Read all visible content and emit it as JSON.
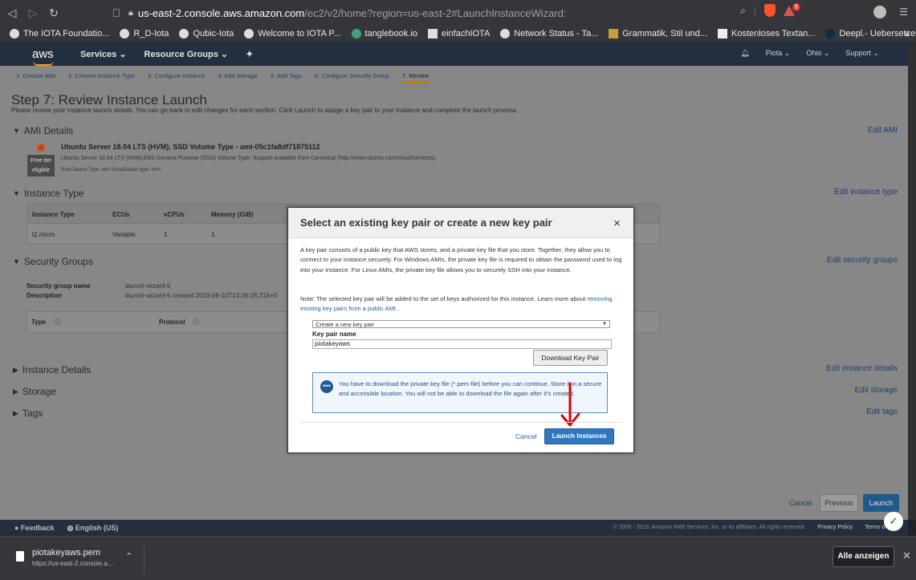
{
  "browser": {
    "url_host": "us-east-2.console.aws.amazon.com",
    "url_path": "/ec2/v2/home?region=us-east-2#LaunchInstanceWizard:",
    "shield_badge": "8",
    "bookmarks": [
      "The IOTA Foundatio...",
      "R_D-Iota",
      "Qubic-Iota",
      "Welcome to IOTA P...",
      "tanglebook.io",
      "einfachIOTA",
      "Network Status - Ta...",
      "Grammatik, Stil und...",
      "Kostenloses Textan...",
      "Deepl.- Uebersetzer"
    ],
    "more": "»"
  },
  "aws": {
    "logo": "aws",
    "services": "Services ⌄",
    "resource_groups": "Resource Groups ⌄",
    "pin": "✦",
    "bell": "♫",
    "user": "Piota ⌄",
    "region": "Ohio ⌄",
    "support": "Support ⌄"
  },
  "wizard": {
    "steps": [
      "1. Choose AMI",
      "2. Choose Instance Type",
      "3. Configure Instance",
      "4. Add Storage",
      "5. Add Tags",
      "6. Configure Security Group",
      "7. Review"
    ],
    "title": "Step 7: Review Instance Launch",
    "description": "Please review your instance launch details. You can go back to edit changes for each section. Click Launch to assign a key pair to your instance and complete the launch process.",
    "sections": {
      "ami": "AMI Details",
      "instance_type": "Instance Type",
      "security_groups": "Security Groups",
      "instance_details": "Instance Details",
      "storage": "Storage",
      "tags": "Tags"
    },
    "edits": {
      "ami": "Edit AMI",
      "instance_type": "Edit instance type",
      "security_groups": "Edit security groups",
      "instance_details": "Edit instance details",
      "storage": "Edit storage",
      "tags": "Edit tags"
    },
    "ami_name": "Ubuntu Server 18.04 LTS (HVM), SSD Volume Type - ami-05c1fa8df71875112",
    "ami_desc": "Ubuntu Server 18.04 LTS (HVM),EBS General Purpose (SSD) Volume Type. Support available from Canonical (http://www.ubuntu.com/cloud/services).",
    "ami_meta": "Root Device Type: ebs    Virtualization type: hvm",
    "free_tier": "Free tier eligible",
    "instance_table": {
      "headers": [
        "Instance Type",
        "ECUs",
        "vCPUs",
        "Memory (GiB)"
      ],
      "row": [
        "t2.micro",
        "Variable",
        "1",
        "1"
      ]
    },
    "sg_name_label": "Security group name",
    "sg_name": "launch-wizard-5",
    "sg_desc_label": "Description",
    "sg_desc": "launch-wizard-5 created 2019-08-10T14:36:26.218+0",
    "sg_table_headers": [
      "Type",
      "Protocol"
    ],
    "cancel": "Cancel",
    "previous": "Previous",
    "launch": "Launch"
  },
  "modal": {
    "title": "Select an existing key pair or create a new key pair",
    "close": "×",
    "para1": "A key pair consists of a public key that AWS stores, and a private key file that you store. Together, they allow you to connect to your instance securely. For Windows AMIs, the private key file is required to obtain the password used to log into your instance. For Linux AMIs, the private key file allows you to securely SSH into your instance.",
    "para2": "Note: The selected key pair will be added to the set of keys authorized for this instance. Learn more about",
    "para2_link": "removing existing key pairs from a public AMI",
    "select_value": "Create a new key pair",
    "key_pair_label": "Key pair name",
    "key_pair_value": "piotakeyaws",
    "download_button": "Download Key Pair",
    "info_text": "You have to download the private key file (*.pem file) before you can continue. Store it in a secure and accessible location. You will not be able to download the file again after it's created.",
    "cancel": "Cancel",
    "launch": "Launch Instances"
  },
  "footer": {
    "feedback": "Feedback",
    "language": "English (US)",
    "copyright": "© 2008 - 2019, Amazon Web Services, Inc. or its affiliates. All rights reserved.",
    "privacy": "Privacy Policy",
    "terms": "Terms of U"
  },
  "downloads": {
    "filename": "piotakeyaws.pem",
    "url": "https://us-east-2.console.a...",
    "show_all": "Alle anzeigen"
  },
  "colors": {
    "aws_header": "#232f3e",
    "launch_blue": "#2f78c0",
    "overlay": "#878787",
    "annotation_red": "#e00000"
  }
}
